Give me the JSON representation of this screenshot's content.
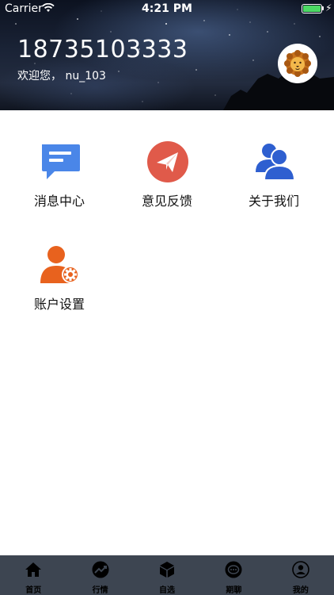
{
  "status_bar": {
    "carrier": "Carrier",
    "time": "4:21 PM",
    "battery_level": 1.0
  },
  "profile": {
    "phone": "18735103333",
    "welcome": "欢迎您，  nu_103",
    "avatar_icon": "lion-icon"
  },
  "menu": {
    "items": [
      {
        "label": "消息中心",
        "icon": "message-icon",
        "color": "#4a86e8"
      },
      {
        "label": "意见反馈",
        "icon": "paper-plane-icon",
        "color": "#e05a4a"
      },
      {
        "label": "关于我们",
        "icon": "users-icon",
        "color": "#2e5fd0"
      },
      {
        "label": "账户设置",
        "icon": "user-settings-icon",
        "color": "#e8621e"
      }
    ]
  },
  "tabbar": {
    "background": "#3d4551",
    "tabs": [
      {
        "label": "首页",
        "icon": "home-icon"
      },
      {
        "label": "行情",
        "icon": "trend-icon"
      },
      {
        "label": "自选",
        "icon": "cube-icon"
      },
      {
        "label": "期聊",
        "icon": "chat-icon"
      },
      {
        "label": "我的",
        "icon": "profile-icon"
      }
    ]
  }
}
